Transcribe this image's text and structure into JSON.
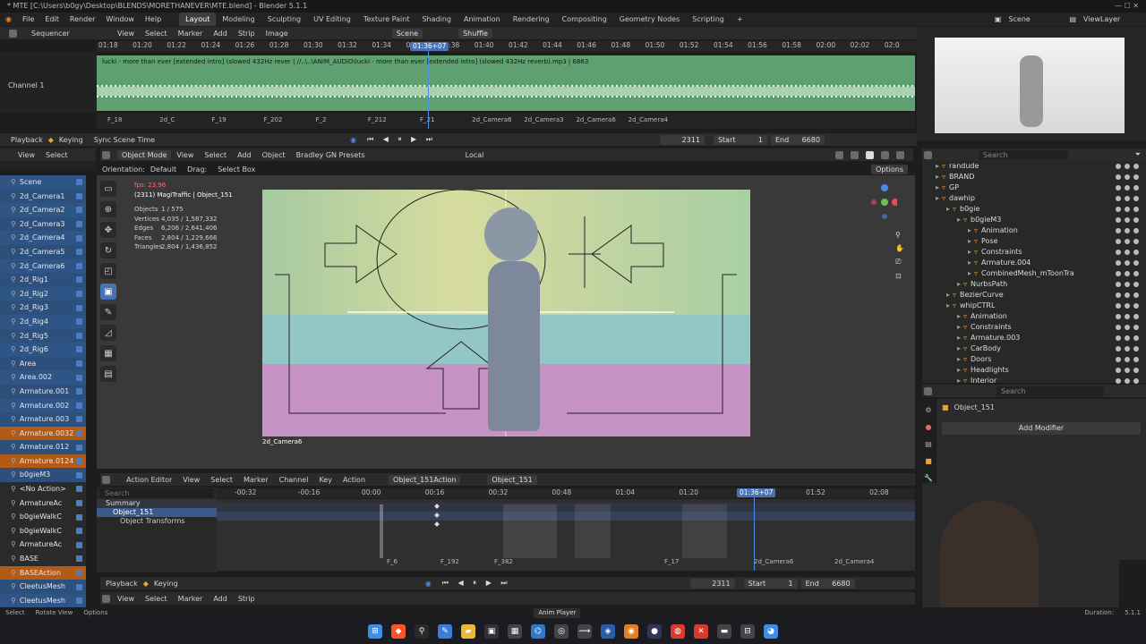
{
  "window": {
    "title": "* MTE [C:\\Users\\b0gy\\Desktop\\BLENDS\\MORETHANEVER\\MTE.blend] - Blender 5.1.1"
  },
  "menu": {
    "file": "File",
    "edit": "Edit",
    "render": "Render",
    "window": "Window",
    "help": "Help"
  },
  "workspaces": [
    "Layout",
    "Modeling",
    "Sculpting",
    "UV Editing",
    "Texture Paint",
    "Shading",
    "Animation",
    "Rendering",
    "Compositing",
    "Geometry Nodes",
    "Scripting"
  ],
  "scene": {
    "name": "Scene",
    "view_layer": "ViewLayer"
  },
  "sequencer": {
    "editor": "Sequencer",
    "menus": [
      "View",
      "Select",
      "Marker",
      "Add",
      "Strip",
      "Image"
    ],
    "scene_field": "Scene",
    "shuffle": "Shuffle",
    "channel_label": "Channel 1",
    "ruler": [
      "01:18",
      "01:20",
      "01:22",
      "01:24",
      "01:26",
      "01:28",
      "01:30",
      "01:32",
      "01:34",
      "01:36+07",
      "01:38",
      "01:40",
      "01:42",
      "01:44",
      "01:46",
      "01:48",
      "01:50",
      "01:52",
      "01:54",
      "01:56",
      "01:58",
      "02:00",
      "02:02",
      "02:0"
    ],
    "playhead": "01:36+07",
    "strip_text": "lucki - more than ever [extended intro] (slowed 432Hz  rever | //..\\..\\ANIM_AUDIO\\lucki - more than ever [extended intro] (slowed  432Hz  reverb).mp3 | 6863",
    "markers": [
      "F_18",
      "2d_C",
      "F_19",
      "F_202",
      "F_2",
      "F_212",
      "F_21",
      "2d_Camera6",
      "2d_Camera3",
      "2d_Camera6",
      "2d_Camera4"
    ]
  },
  "playback_bar": {
    "playback": "Playback",
    "keying": "Keying",
    "sync": "Sync Scene Time",
    "frame": "2311",
    "start_label": "Start",
    "start": "1",
    "end_label": "End",
    "end": "6680"
  },
  "viewport": {
    "mode": "Object Mode",
    "menus": [
      "View",
      "Select",
      "Add",
      "Object"
    ],
    "preset": "Bradley GN Presets",
    "transform": "Local",
    "orientation_label": "Orientation:",
    "orientation": "Default",
    "drag_label": "Drag:",
    "drag": "Select Box",
    "options": "Options",
    "fps": "fps: 23.96",
    "active": "(2311) MagiTraffic | Object_151",
    "stats": [
      {
        "k": "Objects",
        "v": "1 / 575"
      },
      {
        "k": "Vertices",
        "v": "4,035 / 1,587,332"
      },
      {
        "k": "Edges",
        "v": "6,206 / 2,641,406"
      },
      {
        "k": "Faces",
        "v": "2,804 / 1,229,666"
      },
      {
        "k": "Triangles",
        "v": "2,804 / 1,436,852"
      }
    ],
    "camera_label": "2d_Camera6"
  },
  "left_outliner": {
    "menus": [
      "View",
      "Select"
    ],
    "items": [
      "Scene",
      "2d_Camera1",
      "2d_Camera2",
      "2d_Camera3",
      "2d_Camera4",
      "2d_Camera5",
      "2d_Camera6",
      "2d_Rig1",
      "2d_Rig2",
      "2d_Rig3",
      "2d_Rig4",
      "2d_Rig5",
      "2d_Rig6",
      "Area",
      "Area.002",
      "Armature.001",
      "Armature.002",
      "Armature.003",
      "Armature.0032",
      "Armature.012",
      "Armature.0124",
      "b0gieM3",
      "<No Action>",
      "ArmatureAc",
      "b0gieWalkC",
      "b0gieWalkC",
      "ArmatureAc",
      "BASE",
      "BASEAction",
      "CleetusMesh",
      "CleetusMesh"
    ]
  },
  "outliner": {
    "search_placeholder": "Search",
    "items": [
      {
        "label": "randude",
        "depth": 1
      },
      {
        "label": "BRAND",
        "depth": 1
      },
      {
        "label": "GP",
        "depth": 1
      },
      {
        "label": "dawhip",
        "depth": 1
      },
      {
        "label": "b0gie",
        "depth": 2
      },
      {
        "label": "b0gieM3",
        "depth": 3
      },
      {
        "label": "Animation",
        "depth": 4
      },
      {
        "label": "Pose",
        "depth": 4
      },
      {
        "label": "Constraints",
        "depth": 4
      },
      {
        "label": "Armature.004",
        "depth": 4
      },
      {
        "label": "CombinedMesh_mToonTra",
        "depth": 4
      },
      {
        "label": "NurbsPath",
        "depth": 3
      },
      {
        "label": "BezierCurve",
        "depth": 2
      },
      {
        "label": "whipCTRL",
        "depth": 2
      },
      {
        "label": "Animation",
        "depth": 3
      },
      {
        "label": "Constraints",
        "depth": 3
      },
      {
        "label": "Armature.003",
        "depth": 3
      },
      {
        "label": "CarBody",
        "depth": 3
      },
      {
        "label": "Doors",
        "depth": 3
      },
      {
        "label": "Headlights",
        "depth": 3
      },
      {
        "label": "Interior",
        "depth": 3
      }
    ]
  },
  "properties": {
    "search_placeholder": "Search",
    "object": "Object_151",
    "add_modifier": "Add Modifier"
  },
  "action_editor": {
    "editor": "Action Editor",
    "menus": [
      "View",
      "Select",
      "Marker",
      "Channel",
      "Key",
      "Action"
    ],
    "action": "Object_151Action",
    "object": "Object_151",
    "search_placeholder": "Search",
    "ruler": [
      "-00:32",
      "-00:16",
      "00:00",
      "00:16",
      "00:32",
      "00:48",
      "01:04",
      "01:20",
      "01:36+07",
      "01:52",
      "02:08"
    ],
    "channels": [
      "Summary",
      "Object_151",
      "Object Transforms"
    ],
    "markers": [
      "F_6",
      "F_192",
      "F_382",
      "F_17",
      "2d_Camera6",
      "2d_Camera4"
    ]
  },
  "timeline": {
    "playback": "Playback",
    "keying": "Keying",
    "frame": "2311",
    "start_label": "Start",
    "start": "1",
    "end_label": "End",
    "end": "6680",
    "menus": [
      "View",
      "Select",
      "Marker",
      "Add",
      "Strip"
    ]
  },
  "status": {
    "select": "Select",
    "rotate": "Rotate View",
    "options": "Options",
    "center": "Anim Player",
    "duration": "Duration:",
    "version": "5.1.1"
  }
}
